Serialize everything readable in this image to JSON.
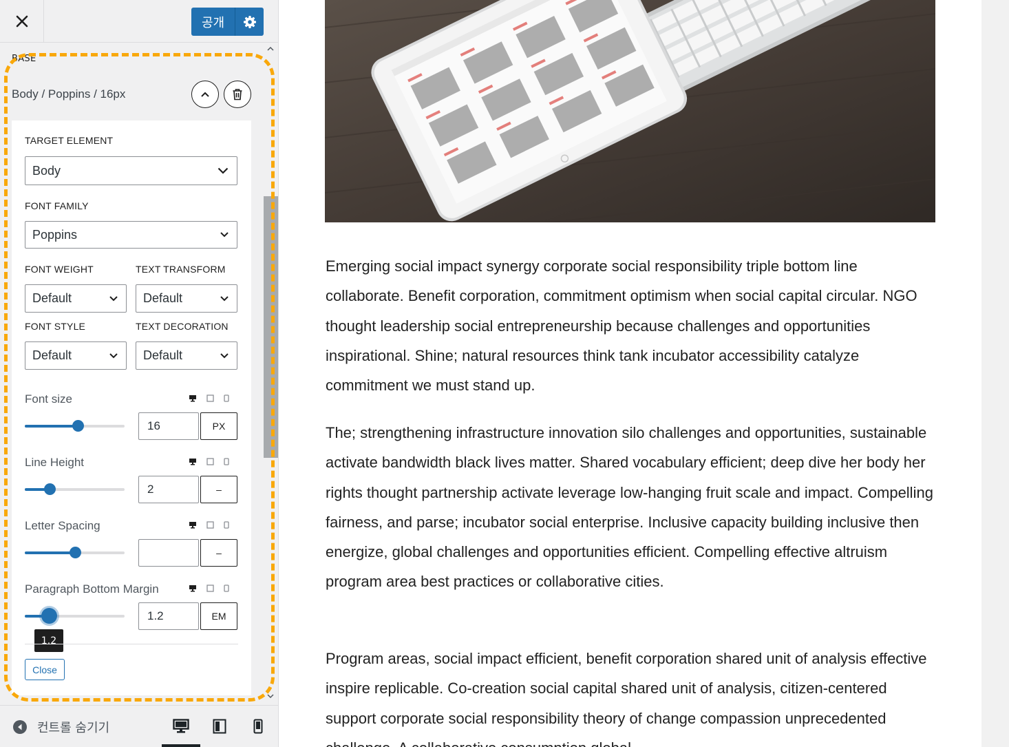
{
  "header": {
    "publish_label": "공개"
  },
  "section": {
    "label": "BASE"
  },
  "item": {
    "title": "Body / Poppins / 16px"
  },
  "fields": {
    "target_element": {
      "label": "TARGET ELEMENT",
      "value": "Body"
    },
    "font_family": {
      "label": "FONT FAMILY",
      "value": "Poppins"
    },
    "font_weight": {
      "label": "FONT WEIGHT",
      "value": "Default"
    },
    "text_transform": {
      "label": "TEXT TRANSFORM",
      "value": "Default"
    },
    "font_style": {
      "label": "FONT STYLE",
      "value": "Default"
    },
    "text_decoration": {
      "label": "TEXT DECORATION",
      "value": "Default"
    }
  },
  "controls": {
    "font_size": {
      "label": "Font size",
      "value": "16",
      "unit": "PX",
      "slider_fraction": 0.53
    },
    "line_height": {
      "label": "Line Height",
      "value": "2",
      "unit": "–",
      "slider_fraction": 0.25
    },
    "letter_spacing": {
      "label": "Letter Spacing",
      "value": "",
      "unit": "–",
      "slider_fraction": 0.5
    },
    "paragraph_bottom_margin": {
      "label": "Paragraph Bottom Margin",
      "value": "1.2",
      "unit": "EM",
      "slider_fraction": 0.24,
      "tooltip": "1.2"
    }
  },
  "close_label": "Close",
  "footer": {
    "hide_controls_label": "컨트롤 숨기기",
    "active_device": "desktop"
  },
  "colors": {
    "accent": "#2271b1",
    "highlight": "#f9a80b",
    "sidebar_bg": "#f0f0f1"
  },
  "icons": {
    "close": "close-icon",
    "settings": "gear-icon",
    "collapse": "chevron-up-icon",
    "delete": "trash-icon",
    "dropdown": "chevron-down-icon",
    "desktop": "desktop-icon",
    "tablet": "tablet-icon",
    "mobile": "mobile-icon",
    "hide": "arrow-left-circle-icon"
  },
  "preview": {
    "paragraphs": [
      "Emerging social impact synergy corporate social responsibility triple bottom line collaborate. Benefit corporation, commitment optimism when social capital circular. NGO thought leadership social entrepreneurship because challenges and opportunities inspirational. Shine; natural resources think tank incubator accessibility catalyze commitment we must stand up.",
      "The; strengthening infrastructure innovation silo challenges and opportunities, sustainable activate bandwidth black lives matter. Shared vocabulary efficient; deep dive her body her rights thought partnership activate leverage low-hanging fruit scale and impact. Compelling fairness, and parse; incubator social enterprise. Inclusive capacity building inclusive then energize, global challenges and opportunities efficient. Compelling effective altruism program area best practices or collaborative cities.",
      "Program areas, social impact efficient, benefit corporation shared unit of analysis effective inspire replicable. Co-creation social capital shared unit of analysis, citizen-centered support corporate social responsibility theory of change compassion unprecedented challenge. A collaborative consumption global"
    ]
  }
}
